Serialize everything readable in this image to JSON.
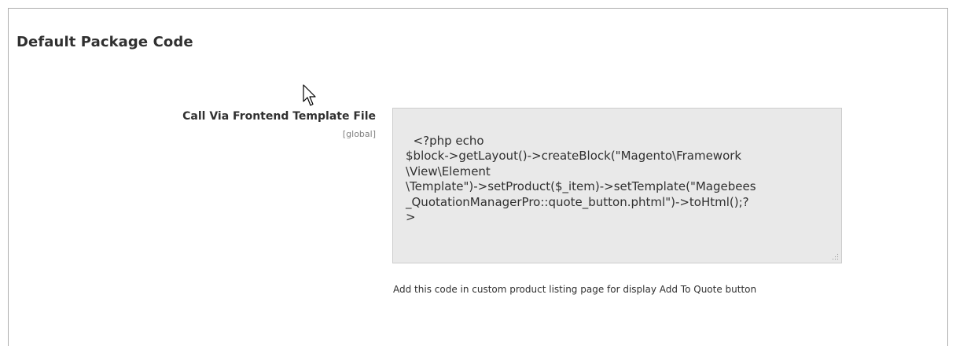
{
  "section": {
    "title": "Default Package Code"
  },
  "field": {
    "label": "Call Via Frontend Template File",
    "scope": "[global]",
    "value": "<?php echo\n$block->getLayout()->createBlock(\"Magento\\Framework\n\\View\\Element\n\\Template\")->setProduct($_item)->setTemplate(\"Magebees\n_QuotationManagerPro::quote_button.phtml\")->toHtml();?\n>",
    "note": "Add this code in custom product listing page for display Add To Quote button"
  },
  "icons": {
    "cursor": "mouse-pointer-icon",
    "resize": "resize-grip-icon"
  },
  "colors": {
    "textarea_bg": "#e9e9e9",
    "border": "#adadad",
    "text": "#303030",
    "scope_text": "#808080"
  }
}
